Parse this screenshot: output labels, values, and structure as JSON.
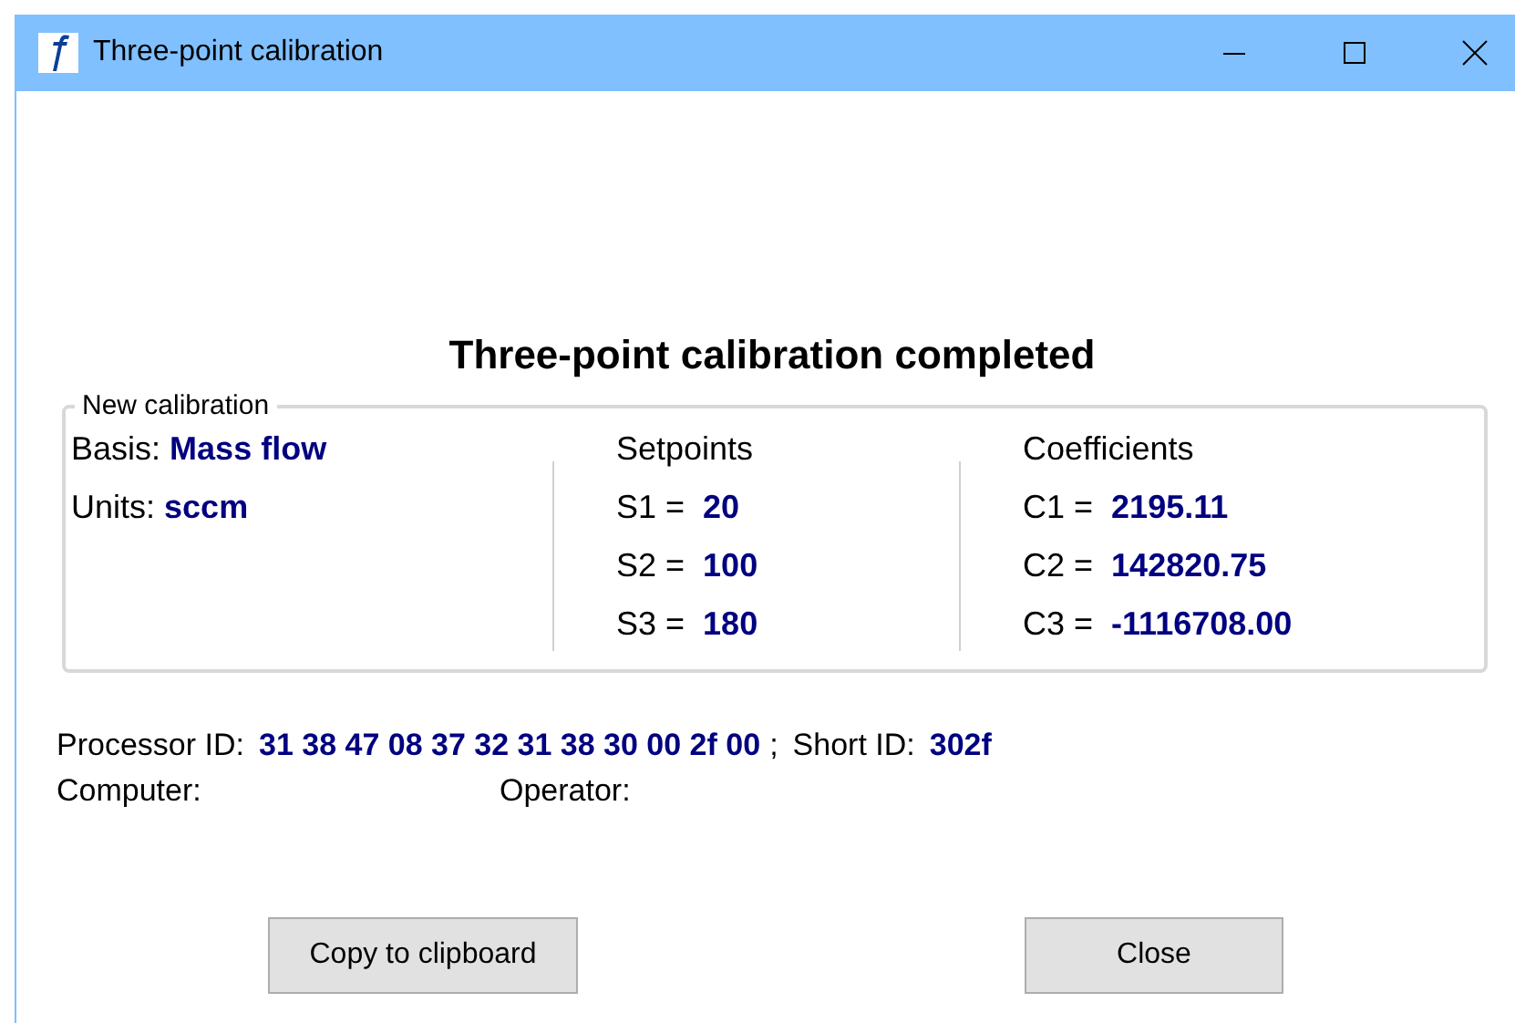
{
  "window": {
    "title": "Three-point calibration"
  },
  "heading": "Three-point calibration completed",
  "group": {
    "legend": "New calibration",
    "basis": {
      "label": "Basis:",
      "value": "Mass flow"
    },
    "units": {
      "label": "Units:",
      "value": "sccm"
    },
    "setpoints": {
      "heading": "Setpoints",
      "items": [
        {
          "label": "S1 =",
          "value": "20"
        },
        {
          "label": "S2 =",
          "value": "100"
        },
        {
          "label": "S3 =",
          "value": "180"
        }
      ]
    },
    "coefficients": {
      "heading": "Coefficients",
      "items": [
        {
          "label": "C1 =",
          "value": "2195.11"
        },
        {
          "label": "C2 =",
          "value": "142820.75"
        },
        {
          "label": "C3 =",
          "value": "-1116708.00"
        }
      ]
    }
  },
  "processor_id": {
    "label": "Processor ID:",
    "value": "31 38 47 08 37 32 31 38 30 00 2f 00",
    "separator": ";"
  },
  "short_id": {
    "label": "Short ID:",
    "value": "302f"
  },
  "computer": {
    "label": "Computer:"
  },
  "operator": {
    "label": "Operator:"
  },
  "buttons": [
    "Copy to clipboard",
    "Close"
  ]
}
